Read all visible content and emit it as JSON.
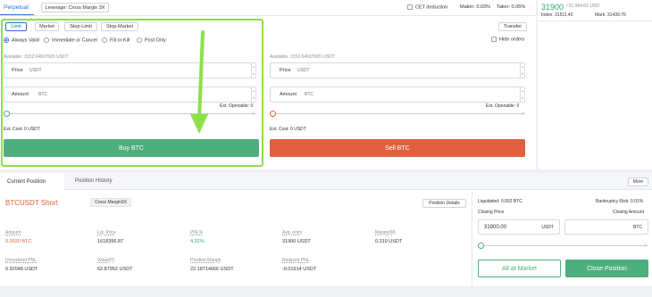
{
  "header": {
    "tab_perpetual": "Perpetual",
    "leverage_label": "Leverage: Cross Margin 3X",
    "cet_deduction": "CET deduction",
    "maker_fee": "Maker: 0.03%",
    "taker_fee": "Taker: 0.05%"
  },
  "ticker": {
    "price": "31900",
    "price_approx": "≈31,954.01 USD",
    "index": "Index: 31511.40",
    "mark": "Mark: 31439.76"
  },
  "order_types": {
    "limit": "Limit",
    "market": "Market",
    "stop_limit": "Stop-Limit",
    "stop_market": "Stop-Market",
    "transfer": "Transfer",
    "hide_orders": "Hide orders"
  },
  "time_in_force": {
    "always_valid": "Always Valid",
    "ioc": "Immediate or Cancel",
    "fok": "Fill or Kill",
    "post_only": "Post Only"
  },
  "buy": {
    "available": "Available: 3152.04607665 USDT",
    "price_label": "Price",
    "price_unit": "USDT",
    "amount_label": "Amount",
    "amount_unit": "BTC",
    "est_openable": "Est. Openable: 0",
    "est_cost": "Est. Cost: 0 USDT",
    "button": "Buy BTC"
  },
  "sell": {
    "available": "Available: 3152.04607665 USDT",
    "price_label": "Price",
    "price_unit": "USDT",
    "amount_label": "Amount",
    "amount_unit": "BTC",
    "est_openable": "Est. Openable: 0",
    "est_cost": "Est. Cost: 0 USDT",
    "button": "Sell BTC"
  },
  "positions": {
    "tab_current": "Current Position",
    "tab_history": "Position History",
    "more": "More",
    "symbol": "BTCUSDT Short",
    "margin_mode": "Cross Margin3X",
    "details_button": "Position Details",
    "fields": [
      {
        "label": "Amount",
        "value": "0.0020 BTC",
        "color": "#e0603f"
      },
      {
        "label": "Liq. Price",
        "value": "1618396.87",
        "color": "#333333"
      },
      {
        "label": "PNL%",
        "value": "4.32%",
        "color": "#2fa66a"
      },
      {
        "label": "Avg. entry",
        "value": "31900 USDT",
        "color": "#333333"
      },
      {
        "label": "Margin(M)",
        "value": "0.319 USDT",
        "color": "#333333"
      },
      {
        "label": "Unrealized PNL",
        "value": "0.92048 USDT",
        "color": "#333333"
      },
      {
        "label": "Value(P)",
        "value": "62.87952 USDT",
        "color": "#333333"
      },
      {
        "label": "Position Margin",
        "value": "22.18714666 USDT",
        "color": "#333333"
      },
      {
        "label": "Realized PNL",
        "value": "-0.01914 USDT",
        "color": "#333333"
      }
    ]
  },
  "close_panel": {
    "liquidated": "Liquidated: 0.002 BTC",
    "bankruptcy_risk": "Bankruptcy Risk: 0.01%",
    "closing_price_label": "Closing Price",
    "closing_amount_label": "Closing Amount",
    "closing_price_value": "31900.00",
    "closing_price_unit": "USDT",
    "closing_amount_unit": "BTC",
    "all_at_market": "All at Market",
    "close_position": "Close Position"
  },
  "colors": {
    "buy": "#4caf7d",
    "sell": "#e0603f",
    "highlight": "#8de04a",
    "accent": "#2e6fd8",
    "price_green": "#2fa66a"
  }
}
